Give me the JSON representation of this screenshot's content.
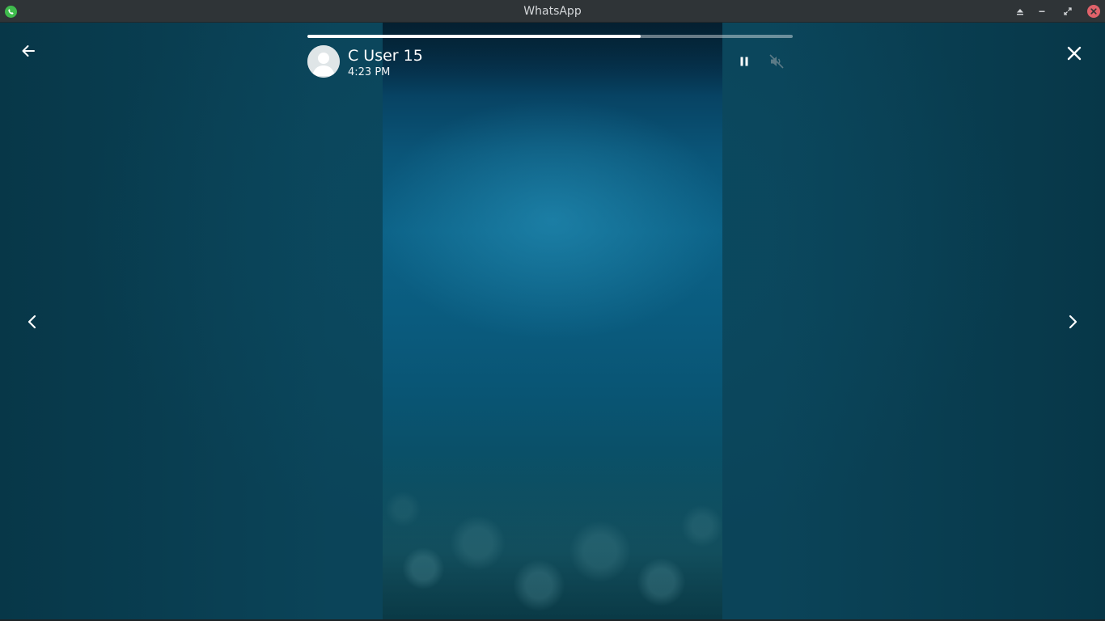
{
  "window": {
    "title": "WhatsApp",
    "app_icon": "whatsapp-logo-icon",
    "controls": [
      "keep-above-icon",
      "minimize-icon",
      "restore-icon",
      "close-icon"
    ]
  },
  "status_viewer": {
    "contact_name": "C User 15",
    "timestamp": "4:23 PM",
    "progress": 0.687,
    "controls": {
      "back": "arrow-left-icon",
      "close": "close-icon",
      "previous": "chevron-left-icon",
      "next": "chevron-right-icon",
      "pause": "pause-icon",
      "mute": "speaker-muted-icon"
    }
  },
  "colors": {
    "titlebar_bg": "#2f3437",
    "stage_bg": "#0b4459",
    "accent_green": "#3fbb4d",
    "close_red": "#e0626a"
  }
}
